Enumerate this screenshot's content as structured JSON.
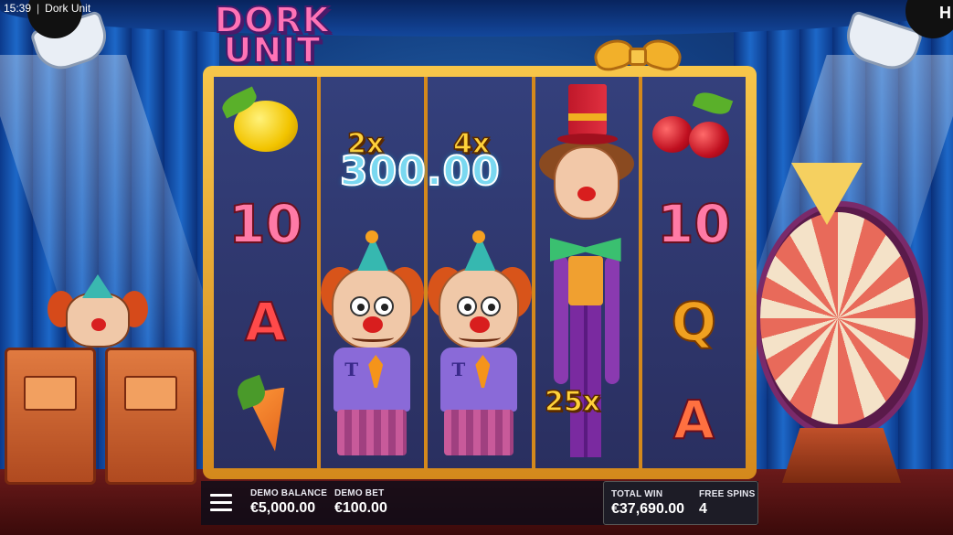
{
  "status_bar": {
    "time": "15:39",
    "separator": "|",
    "app_title": "Dork Unit"
  },
  "logo": {
    "line1": "DORK",
    "line2": "UNIT"
  },
  "reels": [
    {
      "symbols": [
        "lemon",
        "10",
        "A",
        "carrot"
      ]
    },
    {
      "symbols": [
        "clown"
      ]
    },
    {
      "symbols": [
        "clown"
      ]
    },
    {
      "symbols": [
        "tall-clown"
      ]
    },
    {
      "symbols": [
        "cherries",
        "10",
        "Q",
        "A"
      ]
    }
  ],
  "symbols": {
    "reel1_row2": "10",
    "reel1_row3": "A",
    "reel5_row2": "10",
    "reel5_row3": "Q",
    "reel5_row4": "A",
    "clown_shirt_letter": "T"
  },
  "multipliers": {
    "reel2": "2x",
    "reel3": "4x",
    "reel4": "25x"
  },
  "win_display": "300.00",
  "bottom_bar": {
    "balance_label": "DEMO BALANCE",
    "balance_value": "€5,000.00",
    "bet_label": "DEMO BET",
    "bet_value": "€100.00",
    "total_win_label": "TOTAL WIN",
    "total_win_value": "€37,690.00",
    "free_spins_label": "FREE SPINS",
    "free_spins_value": "4"
  },
  "corner_mark": "H",
  "colors": {
    "accent": "#ffd23a",
    "frame": "#f7c64a",
    "win_text": "#7ad8f0",
    "logo": "#ff73b6"
  }
}
